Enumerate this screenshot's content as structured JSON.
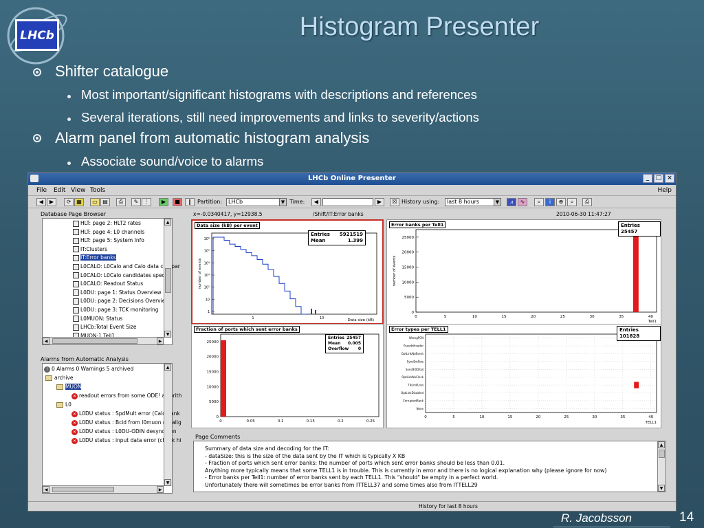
{
  "slide": {
    "title": "Histogram Presenter",
    "bullets": [
      {
        "text": "Shifter catalogue",
        "sub": [
          "Most important/significant histograms with descriptions and references",
          "Several iterations, still need improvements and links to severity/actions"
        ]
      },
      {
        "text": "Alarm panel from automatic histogram analysis",
        "sub": [
          "Associate sound/voice to alarms"
        ]
      }
    ],
    "author": "R. Jacobsson",
    "page_number": "14",
    "logo_text": "LHCb"
  },
  "app": {
    "window_title": "LHCb Online Presenter",
    "menu": {
      "file": "File",
      "edit": "Edit",
      "view": "View",
      "tools": "Tools",
      "help": "Help"
    },
    "toolbar": {
      "partition_label": "Partition:",
      "partition_value": "LHCb",
      "time_label": "Time:",
      "history_label": "History using:",
      "history_value": "last 8 hours"
    },
    "browser": {
      "title": "Database Page Browser",
      "items": [
        "HLT: page 2: HLT2 rates",
        "HLT: page 4: L0 channels",
        "HLT: page 5: System Info",
        "IT:Clusters",
        "IT:Error banks",
        "L0CALO: L0Calo and Calo data compar",
        "L0CALO: L0Calo candidates spectra",
        "L0CALO: Readout Status",
        "L0DU: page 1: Status Overview",
        "L0DU: page 2: Decisions Overview",
        "L0DU: page 3: TCK monitoring",
        "L0MUON: Status",
        "LHCb:Total Event Size",
        "MUON:1.Tell1"
      ],
      "selected_index": 4
    },
    "alarms": {
      "title": "Alarms from Automatic Analysis",
      "summary": "0 Alarms 0 Warnings 5 archived",
      "archive": "archive",
      "muon": "MUON",
      "muon_alarm": "readout errors from some ODE!  algorith",
      "l0": "L0",
      "l0_alarms": [
        "L0DU status : SpdMult error (Calo bank",
        "L0DU status : Bcid from l0muon misalig",
        "L0DU status : L0DU-ODIN desynchron",
        "L0DU status : input data error (check hi"
      ]
    },
    "info": {
      "coords": "x=-0.0340417, y=12938.5",
      "path": "/Shift/IT:Error banks",
      "datetime": "2010-06-30 11:47:27"
    },
    "histograms": {
      "h1": {
        "title": "Data size (kB) per event",
        "entries_label": "Entries",
        "entries": "5921519",
        "mean_label": "Mean",
        "mean": "1.399",
        "ylabel": "number of events",
        "xlabel": "Data size (kB)",
        "yticks": [
          "10⁶",
          "10⁵",
          "10⁴",
          "10³",
          "10²",
          "10",
          "1"
        ],
        "xticks": [
          "1",
          "10"
        ],
        "steps": [
          1.0,
          1.0,
          0.96,
          0.91,
          0.88,
          0.84,
          0.8,
          0.76,
          0.71,
          0.65,
          0.58,
          0.49,
          0.4,
          0.3,
          0.2,
          0.1,
          0.0
        ]
      },
      "h2": {
        "title": "Error banks per Tell1",
        "entries_label": "Entries",
        "entries": "25457",
        "ylabel": "number of events",
        "xlabel": "Tell1",
        "yticks": [
          "25000",
          "20000",
          "15000",
          "10000",
          "5000",
          "0"
        ],
        "xticks": [
          "0",
          "5",
          "10",
          "15",
          "20",
          "25",
          "30",
          "35",
          "40"
        ],
        "bar_x": 37,
        "bar_value": 25457,
        "ymax": 27500,
        "xmax": 41
      },
      "h3": {
        "title": "Fraction of ports which sent error banks",
        "entries_label": "Entries",
        "entries": "25457",
        "mean_label": "Mean",
        "mean": "0.005",
        "overflow_label": "Overflow",
        "overflow": "0",
        "yticks": [
          "25000",
          "20000",
          "15000",
          "10000",
          "5000",
          "0"
        ],
        "xticks": [
          "0",
          "0.05",
          "0.1",
          "0.15",
          "0.2",
          "0.25"
        ],
        "bar_value": 25457,
        "ymax": 27500
      },
      "h4": {
        "title": "Error types per TELL1",
        "entries_label": "Entries",
        "entries": "101828",
        "xlabel": "TELL1",
        "ylabels": [
          "WrongPCN",
          "PseudoHeader",
          "OptLinkNoEvent",
          "SyncEvtSize",
          "SyncBXIDFail",
          "OptLinkNoClock",
          "TlkLinkLoss",
          "OptLinkDisabled",
          "CorruptedBank",
          "None"
        ],
        "xticks": [
          "0",
          "5",
          "10",
          "15",
          "20",
          "25",
          "30",
          "35",
          "40"
        ],
        "bar_x": 37,
        "bar_row": 6
      }
    },
    "comments": {
      "title": "Page Comments",
      "lines": [
        "Summary of data size and decoding for the IT:",
        "- dataSize: this is the size of the data sent by the IT which is typically X KB",
        "- Fraction of ports which sent error banks: the number of ports which sent error banks should be less than 0.01.",
        "Anything more typically means that some TELL1 is in trouble. This is currently in error and there is no logical explanation why (please ignore for now)",
        "- Error banks per Tell1: number of error banks sent by each TELL1. This \"should\" be empty in a perfect world.",
        "Unfortunately there will sometimes be error banks from ITTELL37 and some times also from ITTELL29"
      ]
    },
    "status": {
      "history": "History for last 8 hours"
    },
    "colors": {
      "accent": "#1f4f93",
      "bar": "#e31a1c",
      "highlight": "#c8302a"
    }
  }
}
